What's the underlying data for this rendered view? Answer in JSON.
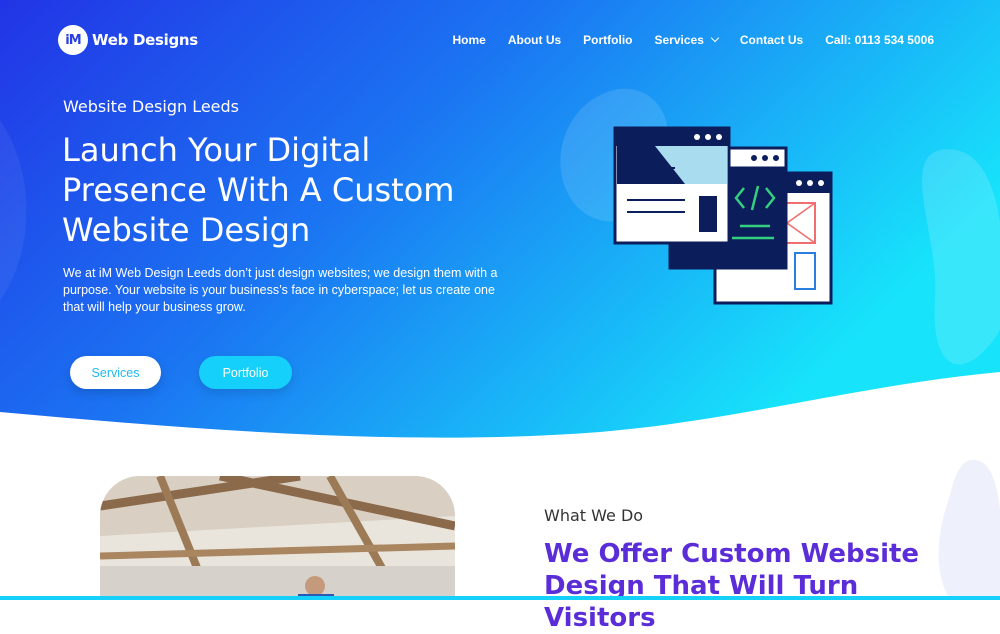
{
  "brand": {
    "logo_mark": "iM",
    "name": "Web Designs"
  },
  "nav": {
    "items": [
      {
        "label": "Home"
      },
      {
        "label": "About Us"
      },
      {
        "label": "Portfolio"
      },
      {
        "label": "Services"
      },
      {
        "label": "Contact Us"
      },
      {
        "label": "Call: 0113 534 5006"
      }
    ]
  },
  "hero": {
    "eyebrow": "Website Design Leeds",
    "headline": "Launch Your Digital Presence With A Custom Website Design",
    "description": "We at iM Web Design Leeds don’t just design websites; we design them with a purpose. Your website is your business’s face in cyberspace; let us create one that will help your business grow.",
    "buttons": {
      "services": "Services",
      "portfolio": "Portfolio"
    },
    "illustration_icon": "browser-windows-code-illustration"
  },
  "what_we_do": {
    "eyebrow": "What We Do",
    "title": "We Offer Custom Website Design That Will Turn Visitors"
  },
  "colors": {
    "gradient_start": "#2032e6",
    "gradient_end": "#17e0fb",
    "accent_cyan": "#14d0fb",
    "heading_purple": "#5b2dd8"
  }
}
